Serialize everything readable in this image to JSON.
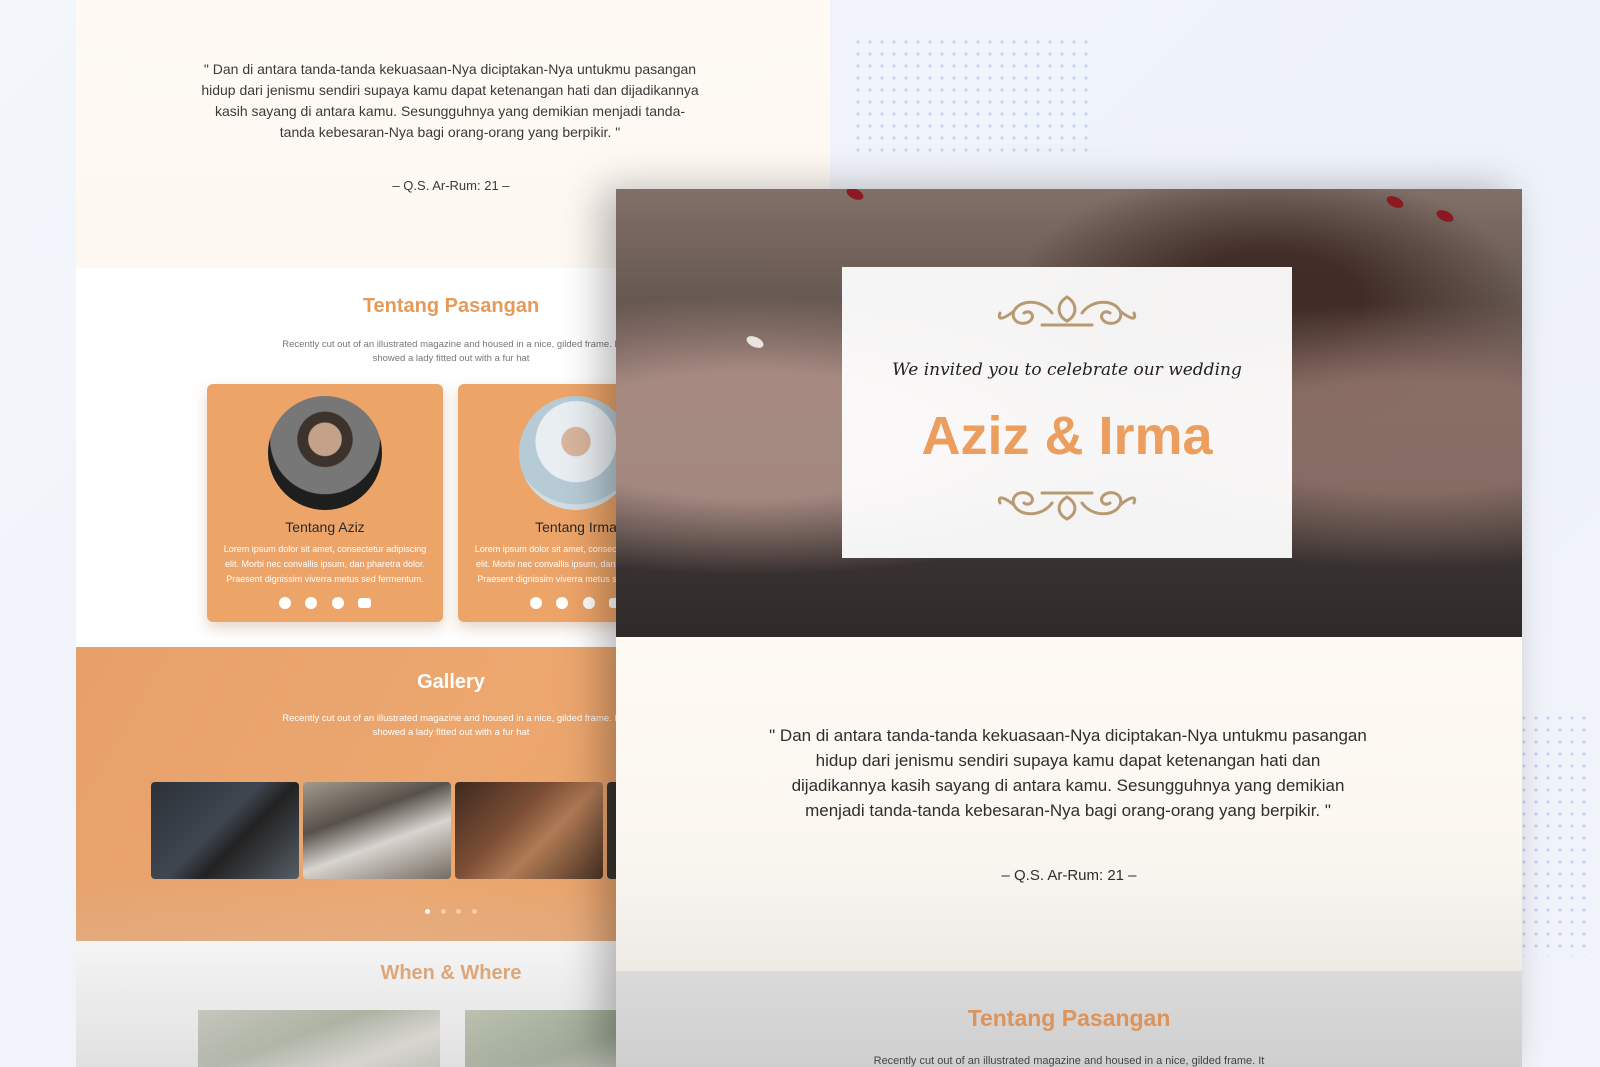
{
  "back_page": {
    "quote": "\" Dan di antara tanda-tanda kekuasaan-Nya diciptakan-Nya untukmu pasangan hidup dari jenismu sendiri supaya kamu dapat ketenangan hati dan dijadikannya kasih sayang di antara kamu. Sesungguhnya yang demikian menjadi tanda-tanda kebesaran-Nya bagi orang-orang yang berpikir. \"",
    "quote_source": "– Q.S. Ar-Rum: 21 –",
    "couple_title": "Tentang Pasangan",
    "couple_subtitle": "Recently cut out of an illustrated magazine and housed in a nice, gilded frame. It showed a lady fitted out with a fur hat",
    "cards": [
      {
        "name": "Tentang Aziz",
        "text": "Lorem ipsum dolor sit amet, consectetur adipiscing elit. Morbi nec convallis ipsum, dan pharetra dolor. Praesent dignissim viverra metus sed fermentum.",
        "socials": [
          "facebook-icon",
          "instagram-icon",
          "telegram-icon",
          "youtube-icon"
        ]
      },
      {
        "name": "Tentang Irma",
        "text": "Lorem ipsum dolor sit amet, consectetur adipiscing elit. Morbi nec convallis ipsum, dan pharetra dolor. Praesent dignissim viverra metus sed fermentum.",
        "socials": [
          "facebook-icon",
          "instagram-icon",
          "telegram-icon",
          "youtube-icon"
        ]
      }
    ],
    "gallery": {
      "title": "Gallery",
      "subtitle": "Recently cut out of an illustrated magazine and housed in a nice, gilded frame. It showed a lady fitted out with a fur hat",
      "images": [
        "groom-suit-photo",
        "wedding-confetti-photo",
        "henna-hands-photo",
        "partial-photo"
      ],
      "active_dot": 0,
      "dot_count": 4
    },
    "when_where": {
      "title": "When & Where"
    }
  },
  "front_page": {
    "hero": {
      "invite_text": "We invited you to celebrate our wedding",
      "couple_names": "Aziz & Irma"
    },
    "quote": "\" Dan di antara tanda-tanda kekuasaan-Nya diciptakan-Nya untukmu pasangan hidup dari jenismu sendiri supaya kamu dapat ketenangan hati dan dijadikannya kasih sayang di antara kamu. Sesungguhnya yang demikian menjadi tanda-tanda kebesaran-Nya bagi orang-orang yang berpikir. \"",
    "quote_source": "– Q.S. Ar-Rum: 21 –",
    "couple_title": "Tentang Pasangan",
    "couple_subtitle": "Recently cut out of an illustrated magazine and housed in a nice, gilded frame. It"
  },
  "colors": {
    "accent": "#eb9e5e",
    "card": "#eda468",
    "ornament": "#b89a72"
  }
}
